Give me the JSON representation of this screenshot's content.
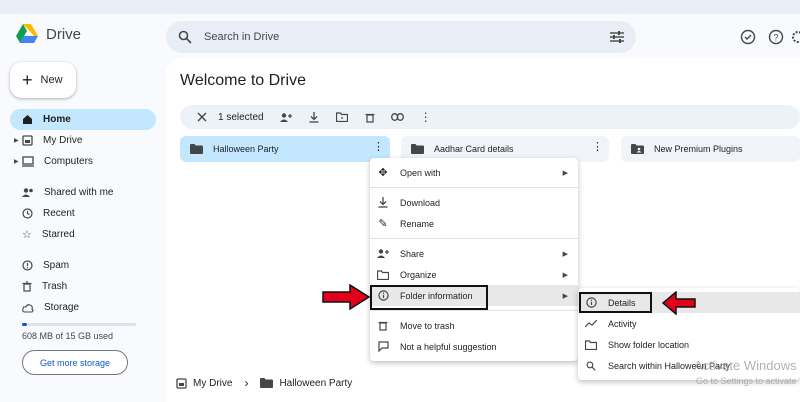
{
  "app": {
    "name": "Drive"
  },
  "search": {
    "placeholder": "Search in Drive"
  },
  "new_button": {
    "label": "New"
  },
  "nav": [
    {
      "label": "Home",
      "icon": "home-icon",
      "active": true
    },
    {
      "label": "My Drive",
      "icon": "my-drive-icon"
    },
    {
      "label": "Computers",
      "icon": "computers-icon"
    },
    {
      "label": "Shared with me",
      "icon": "shared-icon"
    },
    {
      "label": "Recent",
      "icon": "clock-icon"
    },
    {
      "label": "Starred",
      "icon": "star-icon"
    },
    {
      "label": "Spam",
      "icon": "spam-icon"
    },
    {
      "label": "Trash",
      "icon": "trash-icon"
    },
    {
      "label": "Storage",
      "icon": "cloud-icon"
    }
  ],
  "storage": {
    "used_text": "608 MB of 15 GB used",
    "used_fraction": 0.04,
    "button": "Get more storage"
  },
  "page_title": "Welcome to Drive",
  "selection_bar": {
    "count_label": "1 selected"
  },
  "folders": [
    {
      "name": "Halloween Party",
      "selected": true
    },
    {
      "name": "Aadhar Card details",
      "selected": false
    },
    {
      "name": "New Premium Plugins",
      "selected": false
    }
  ],
  "context_menu": {
    "open_with": "Open with",
    "download": "Download",
    "rename": "Rename",
    "share": "Share",
    "organize": "Organize",
    "folder_information": "Folder information",
    "move_to_trash": "Move to trash",
    "not_helpful": "Not a helpful suggestion"
  },
  "submenu": {
    "details": "Details",
    "activity": "Activity",
    "show_folder_location": "Show folder location",
    "search_within": "Search within Halloween Party"
  },
  "breadcrumb": {
    "root": "My Drive",
    "current": "Halloween Party"
  },
  "watermark": {
    "line1": "Activate Windows",
    "line2": "Go to Settings to activate"
  },
  "colors": {
    "accent": "#0b57d0",
    "selected": "#c2e7ff",
    "arrow": "#e3001b"
  }
}
